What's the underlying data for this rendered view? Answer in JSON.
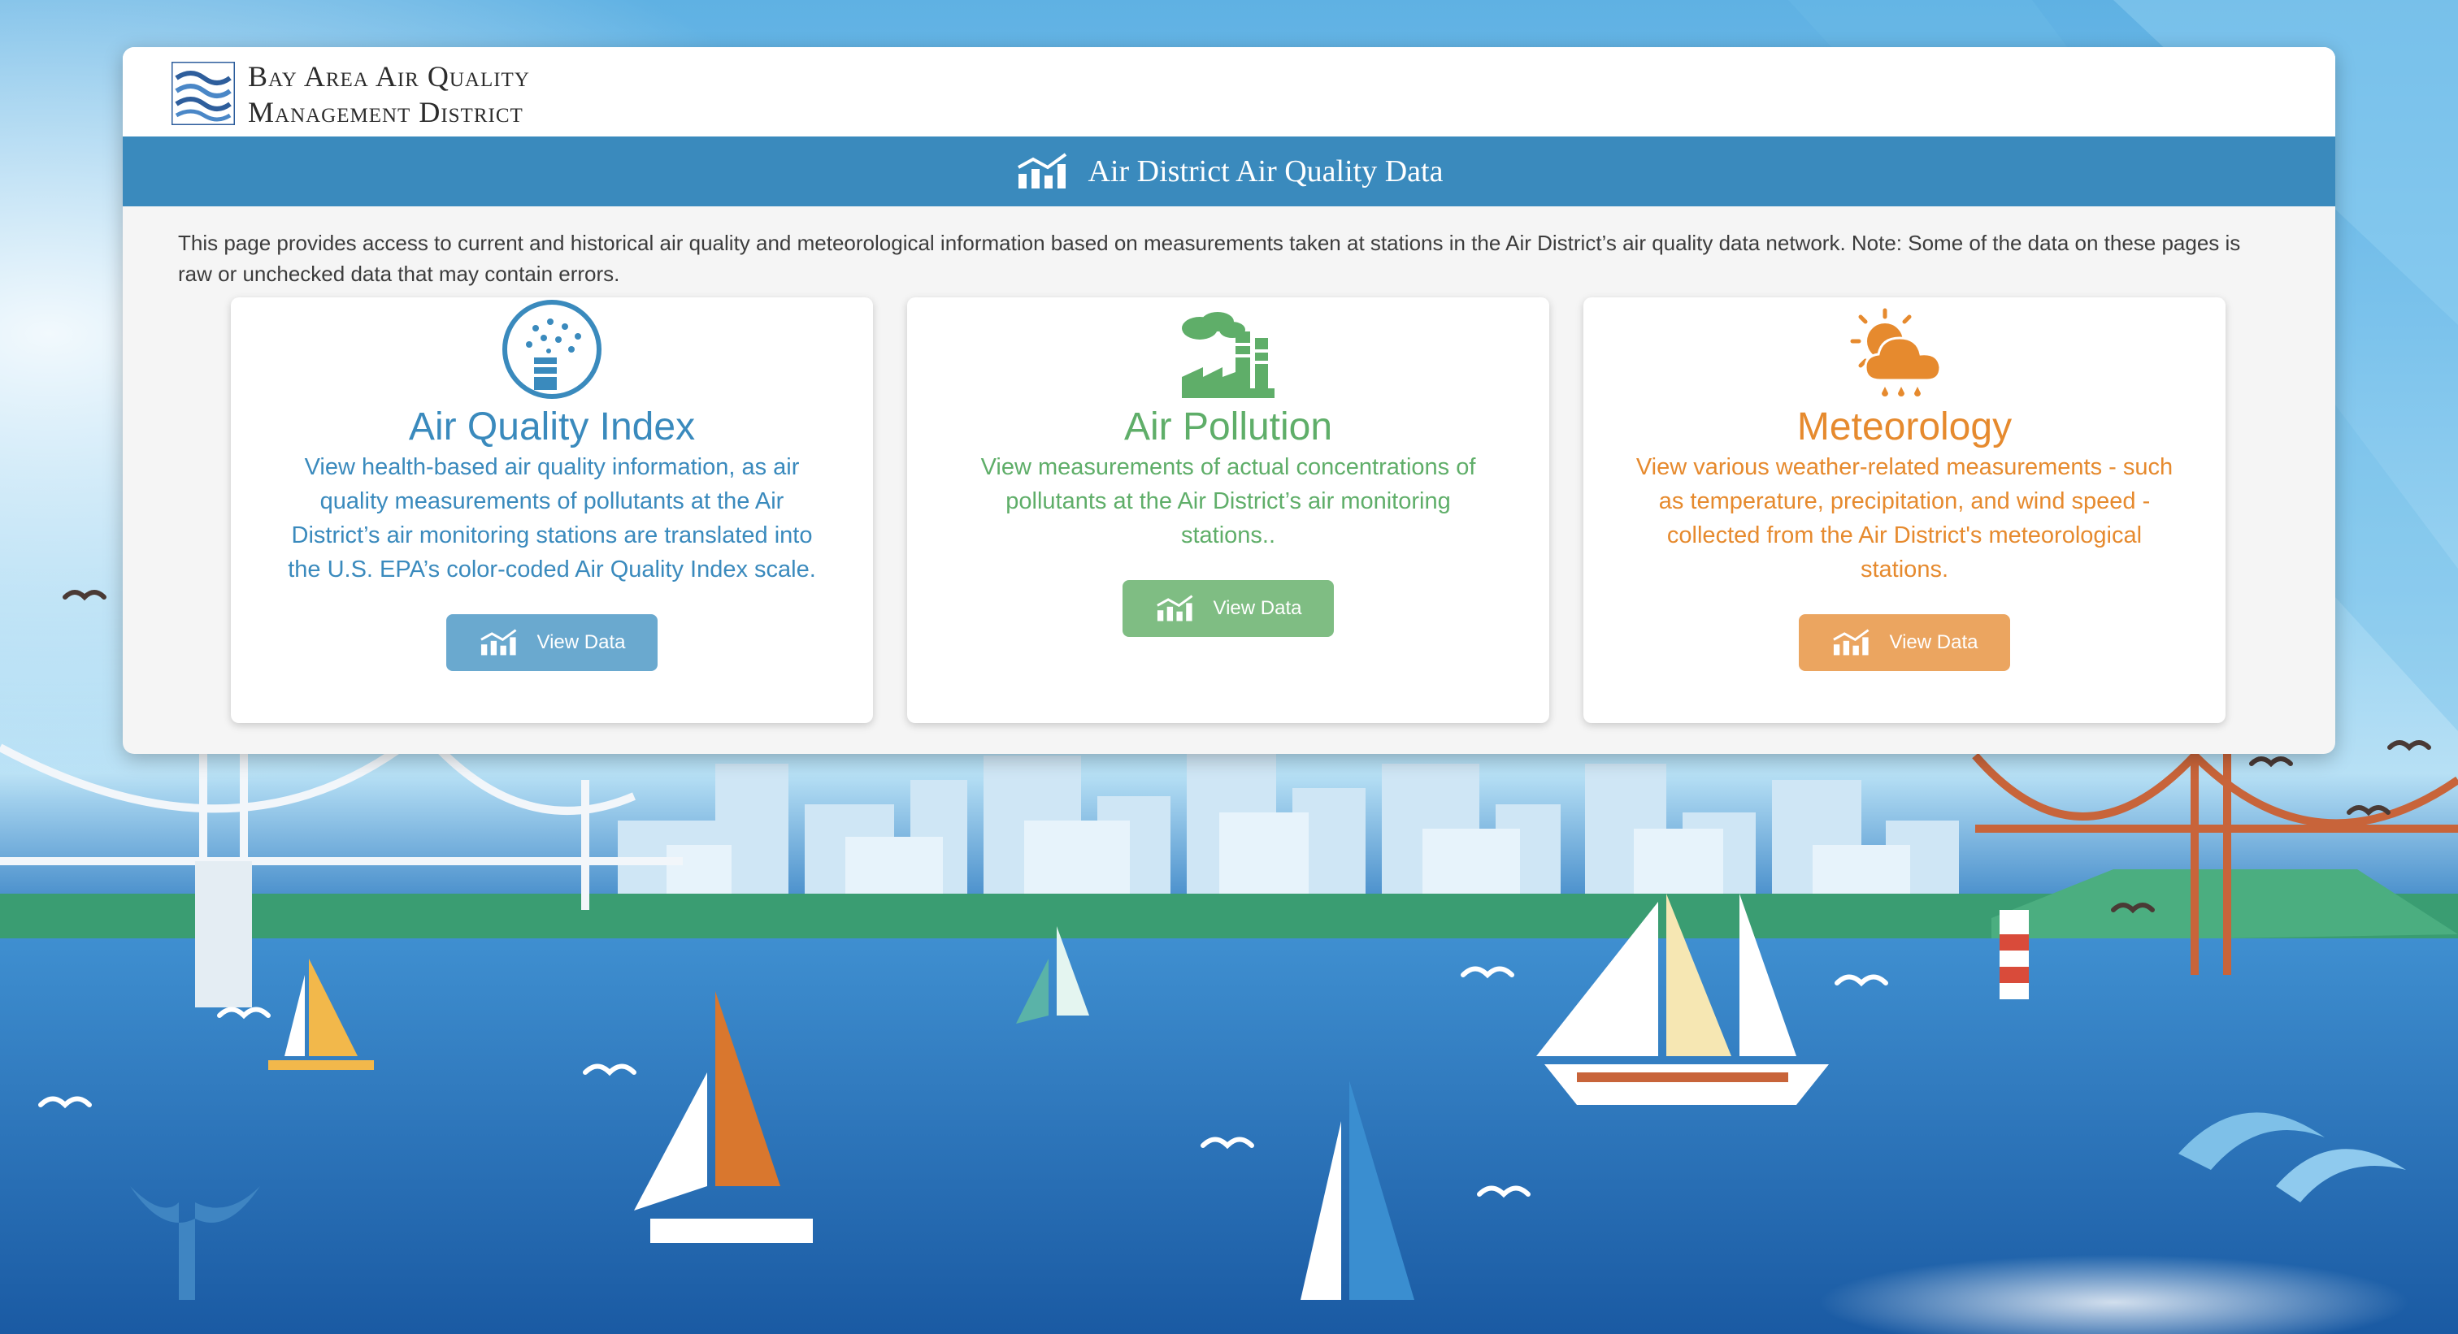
{
  "header": {
    "logo_line1": "Bay Area Air Quality",
    "logo_line2": "Management District",
    "page_title": "Air District Air Quality Data"
  },
  "intro": "This page provides access to current and historical air quality and meteorological information based on measurements taken at stations in the Air District’s air quality data network. Note: Some of the data on these pages is raw or unchecked data that may contain errors.",
  "cards": {
    "aqi": {
      "title": "Air Quality Index",
      "description": "View health-based air quality information, as air quality measurements of pollutants at the Air District’s air monitoring stations are translated into the U.S. EPA’s color-coded Air Quality Index scale.",
      "button": "View Data",
      "icon": "air-quality-gauge-icon",
      "color": "#3a8abd"
    },
    "ap": {
      "title": "Air Pollution",
      "description": "View measurements of actual concentrations of pollutants at the Air District’s air monitoring stations..",
      "button": "View Data",
      "icon": "factory-smoke-icon",
      "color": "#5fae69"
    },
    "met": {
      "title": "Meteorology",
      "description": "View various weather-related measurements - such as temperature, precipitation, and wind speed - collected from the Air District's meteorological stations.",
      "button": "View Data",
      "icon": "sun-cloud-rain-icon",
      "color": "#e68a2e"
    }
  }
}
